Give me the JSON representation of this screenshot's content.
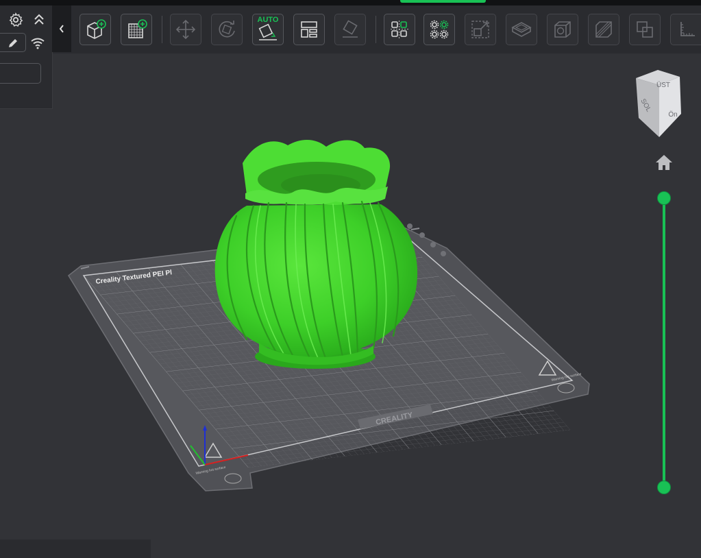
{
  "colors": {
    "accent": "#19c155",
    "model": "#3ed62a",
    "background": "#323337"
  },
  "left_panel": {
    "icons": [
      "settings-icon",
      "collapse-up-icon",
      "edit-icon",
      "wifi-icon"
    ],
    "input_value": ""
  },
  "toolbar": {
    "collapse_icon": "chevron-left-icon",
    "buttons": [
      {
        "name": "add-model-button",
        "icon": "add-cube-icon"
      },
      {
        "name": "add-plate-button",
        "icon": "add-plate-icon"
      },
      {
        "name": "move-button",
        "icon": "move-icon"
      },
      {
        "name": "rotate-button",
        "icon": "rotate-icon"
      },
      {
        "name": "auto-orient-button",
        "icon": "auto-orient-icon",
        "label": "AUTO"
      },
      {
        "name": "arrange-button",
        "icon": "arrange-icon"
      },
      {
        "name": "lay-on-face-button",
        "icon": "lay-on-face-icon"
      },
      {
        "name": "support-paint-button",
        "icon": "support-paint-icon"
      },
      {
        "name": "settings-grid-button",
        "icon": "settings-grid-icon"
      },
      {
        "name": "scale-button",
        "icon": "scale-icon"
      },
      {
        "name": "cut-button",
        "icon": "cut-icon"
      },
      {
        "name": "hollow-button",
        "icon": "hollow-icon"
      },
      {
        "name": "split-button",
        "icon": "split-icon"
      },
      {
        "name": "boolean-button",
        "icon": "boolean-icon"
      },
      {
        "name": "measure-button",
        "icon": "measure-icon"
      }
    ]
  },
  "viewport": {
    "bed_label": "Creality Textured PEI Pl",
    "bed_brand": "CREALITY",
    "warning_text": "Warning hot surface"
  },
  "view_cube": {
    "top": "ÜST",
    "front": "Ön",
    "left": "SOL"
  },
  "layer_slider": {
    "lower": 0.0,
    "upper": 1.0
  }
}
